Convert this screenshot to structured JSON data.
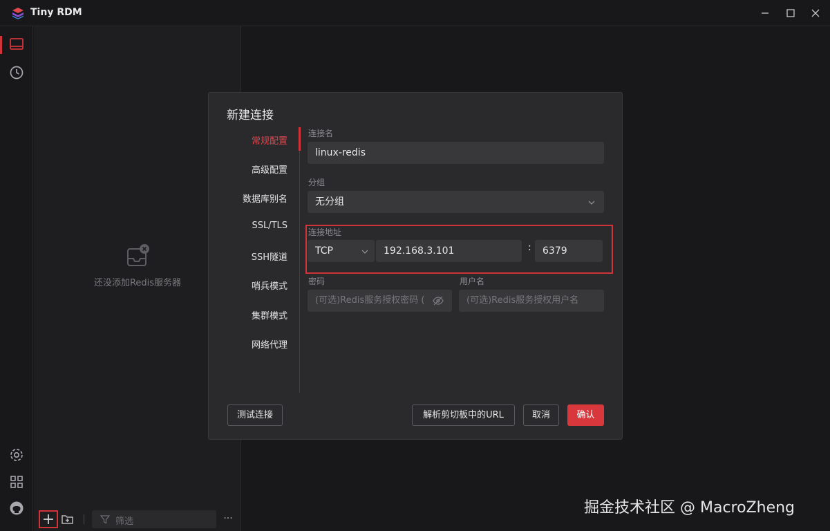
{
  "app": {
    "title": "Tiny RDM",
    "accent": "#d0343a"
  },
  "window_controls": [
    "minimize-icon",
    "maximize-icon",
    "close-icon"
  ],
  "rail": {
    "top_icons": [
      "server-icon",
      "history-icon"
    ],
    "bottom_icons": [
      "settings-icon",
      "apps-icon",
      "github-icon"
    ]
  },
  "sidebar": {
    "empty_text": "还没添加Redis服务器",
    "filter_placeholder": "筛选",
    "more": "···"
  },
  "dialog": {
    "title": "新建连接",
    "nav": [
      "常规配置",
      "高级配置",
      "数据库别名",
      "SSL/TLS",
      "SSH隧道",
      "哨兵模式",
      "集群模式",
      "网络代理"
    ],
    "active_nav": "常规配置",
    "name_label": "连接名",
    "name_value": "linux-redis",
    "group_label": "分组",
    "group_value": "无分组",
    "addr_label": "连接地址",
    "protocol": "TCP",
    "host": "192.168.3.101",
    "colon": ":",
    "port": "6379",
    "password_label": "密码",
    "password_placeholder": "(可选)Redis服务授权密码 (",
    "username_label": "用户名",
    "username_placeholder": "(可选)Redis服务授权用户名",
    "buttons": {
      "test": "测试连接",
      "parse_url": "解析剪切板中的URL",
      "cancel": "取消",
      "confirm": "确认"
    }
  },
  "watermark": "掘金技术社区 @ MacroZheng"
}
